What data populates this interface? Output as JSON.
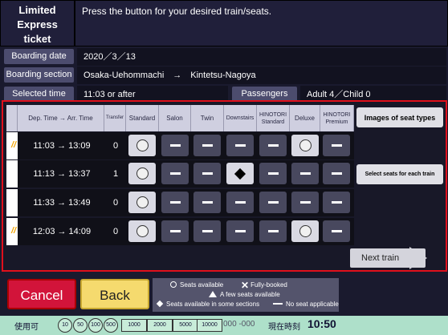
{
  "header": {
    "title_line1": "Limited",
    "title_line2": "Express",
    "title_line3": "ticket",
    "instruction": "Press the button for your desired train/seats."
  },
  "info": {
    "boarding_date_label": "Boarding date",
    "boarding_date_value": "2020／3／13",
    "boarding_section_label": "Boarding section",
    "boarding_section_value": "Osaka-Uehommachi　→　Kintetsu-Nagoya",
    "selected_time_label": "Selected time",
    "selected_time_value": "11:03 or after",
    "passengers_label": "Passengers",
    "passengers_value": "Adult 4／Child 0"
  },
  "table": {
    "headers": [
      "Dep. Time → Arr. Time",
      "Transfer",
      "Standard",
      "Salon",
      "Twin",
      "Downstairs",
      "HINOTORI Standard",
      "Deluxe",
      "HINOTORI Premium"
    ],
    "rows": [
      {
        "time": "11:03 → 13:09",
        "transfer": "0",
        "seats": [
          "available",
          "none",
          "none",
          "none",
          "none",
          "available",
          "none"
        ]
      },
      {
        "time": "11:13 → 13:37",
        "transfer": "1",
        "seats": [
          "available",
          "none",
          "none",
          "some_sections",
          "none",
          "none",
          "none"
        ]
      },
      {
        "time": "11:33 → 13:49",
        "transfer": "0",
        "seats": [
          "available",
          "none",
          "none",
          "none",
          "none",
          "none",
          "none"
        ]
      },
      {
        "time": "12:03 → 14:09",
        "transfer": "0",
        "seats": [
          "available",
          "none",
          "none",
          "none",
          "none",
          "available",
          "none"
        ]
      }
    ],
    "logo_glyph": "//"
  },
  "buttons": {
    "images_of_seat_types": "Images of seat types",
    "select_seats_each_train": "Select seats for each train",
    "next_train": "Next train",
    "cancel": "Cancel",
    "back": "Back"
  },
  "legend": {
    "available": "Seats available",
    "fully_booked": "Fully-booked",
    "few": "A few seats available",
    "some_sections": "Seats available in some sections",
    "no_seat": "No seat applicable"
  },
  "footer": {
    "usable_label": "使用可",
    "coins": [
      "10",
      "50",
      "100",
      "500"
    ],
    "notes": [
      "1000",
      "2000",
      "5000",
      "10000"
    ],
    "change_display": "000 -000",
    "current_time_label": "現在時刻",
    "current_time": "10:50"
  },
  "colors": {
    "background": "#1a1a2e",
    "panel_border": "#e0101c",
    "cancel": "#d2143a",
    "back": "#f5da6e",
    "footer": "#aee0ca"
  }
}
